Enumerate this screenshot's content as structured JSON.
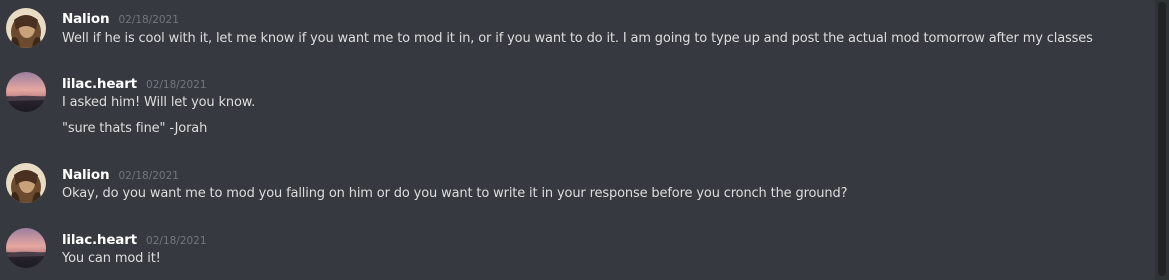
{
  "messages": [
    {
      "author": "Nalion",
      "timestamp": "02/18/2021",
      "avatar": "nalion-avatar",
      "lines": [
        "Well if he is cool with it, let me know if you want me to mod it in, or if you want to do it. I am going to type up and post the actual mod tomorrow after my classes"
      ]
    },
    {
      "author": "lilac.heart",
      "timestamp": "02/18/2021",
      "avatar": "lilac-avatar",
      "lines": [
        "I asked him! Will let you know.",
        "\"sure thats fine\" -Jorah"
      ]
    },
    {
      "author": "Nalion",
      "timestamp": "02/18/2021",
      "avatar": "nalion-avatar",
      "lines": [
        "Okay, do you want me to mod you falling on him or do you want to write it in your response before you cronch the ground?"
      ]
    },
    {
      "author": "lilac.heart",
      "timestamp": "02/18/2021",
      "avatar": "lilac-avatar",
      "lines": [
        "You can mod it!"
      ]
    }
  ],
  "colors": {
    "background": "#36393f",
    "username": "#ffffff",
    "timestamp": "#72767d",
    "message_text": "#dcddde"
  }
}
